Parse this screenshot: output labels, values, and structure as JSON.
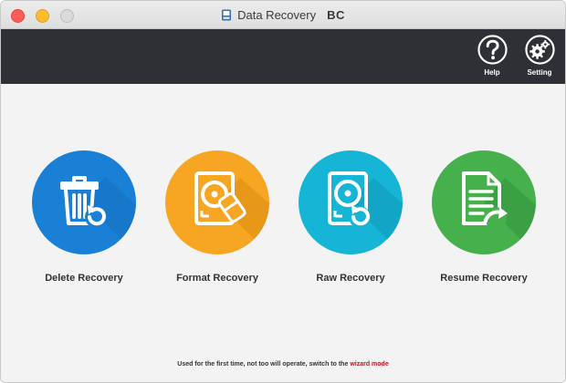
{
  "window": {
    "title": "Data Recovery",
    "brand": "BC"
  },
  "toolbar": {
    "help_label": "Help",
    "setting_label": "Setting"
  },
  "modes": [
    {
      "label": "Delete Recovery",
      "color": "#1a80d6",
      "icon": "trash-restore-icon"
    },
    {
      "label": "Format Recovery",
      "color": "#f6a623",
      "icon": "hard-drive-eraser-icon"
    },
    {
      "label": "Raw Recovery",
      "color": "#17b5d5",
      "icon": "hard-drive-restore-icon"
    },
    {
      "label": "Resume Recovery",
      "color": "#45b04c",
      "icon": "document-resume-icon"
    }
  ],
  "footer": {
    "text": "Used for the first time, not too will operate, switch to the",
    "link": "wizard mode",
    "link_color": "#c0161d"
  }
}
